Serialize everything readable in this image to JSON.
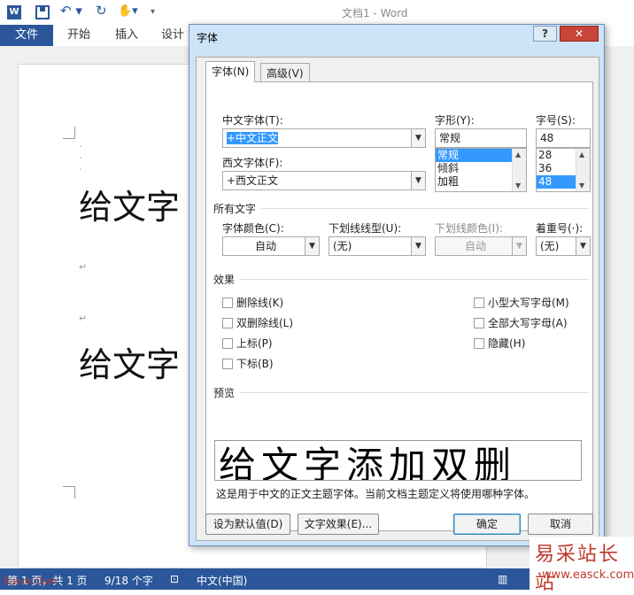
{
  "window": {
    "title": "文档1 - Word"
  },
  "ribbon": {
    "file": "文件",
    "tabs": [
      "开始",
      "插入",
      "设计"
    ]
  },
  "document": {
    "line1": "给文字",
    "line2": "给文字"
  },
  "status": {
    "page": "第 1 页，共 1 页",
    "words": "9/18 个字",
    "lang": "中文(中国)"
  },
  "dialog": {
    "title": "字体",
    "help": "?",
    "tabs": [
      "字体(N)",
      "高级(V)"
    ],
    "cn_font_label": "中文字体(T):",
    "cn_font_value": "+中文正文",
    "west_font_label": "西文字体(F):",
    "west_font_value": "+西文正文",
    "style_label": "字形(Y):",
    "style_value": "常规",
    "style_options": [
      "常规",
      "倾斜",
      "加粗"
    ],
    "size_label": "字号(S):",
    "size_value": "48",
    "size_options": [
      "28",
      "36",
      "48"
    ],
    "all_text_heading": "所有文字",
    "color_label": "字体颜色(C):",
    "color_value": "自动",
    "underline_label": "下划线线型(U):",
    "underline_value": "(无)",
    "underline_color_label": "下划线颜色(I):",
    "underline_color_value": "自动",
    "emphasis_label": "着重号(·):",
    "emphasis_value": "(无)",
    "effects_heading": "效果",
    "effects_left": [
      "删除线(K)",
      "双删除线(L)",
      "上标(P)",
      "下标(B)"
    ],
    "effects_right": [
      "小型大写字母(M)",
      "全部大写字母(A)",
      "隐藏(H)"
    ],
    "preview_heading": "预览",
    "preview_text": "给文字添加双删",
    "preview_note": "这是用于中文的正文主题字体。当前文档主题定义将使用哪种字体。",
    "btn_default": "设为默认值(D)",
    "btn_effects": "文字效果(E)...",
    "btn_ok": "确定",
    "btn_cancel": "取消"
  },
  "watermark": {
    "cn": "易采站长站",
    "url": "www.easck.com",
    "left": "Easck.Com"
  }
}
